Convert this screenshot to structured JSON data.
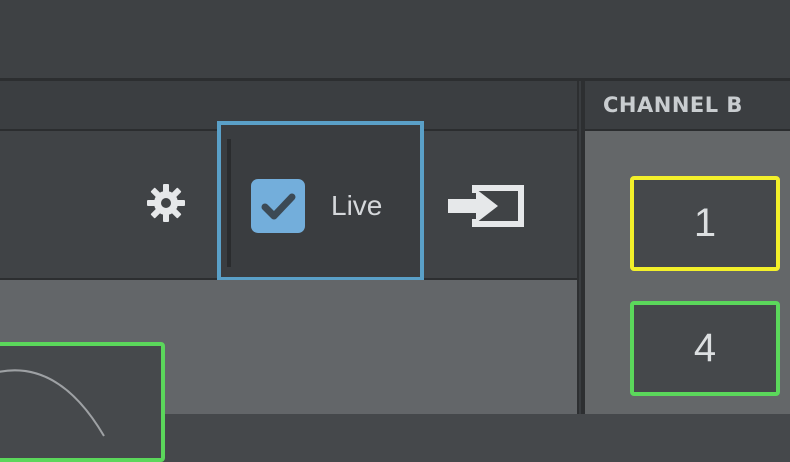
{
  "toolbar": {
    "settings_icon": "gear-icon",
    "live_toggle": {
      "label": "Live",
      "checked": true,
      "icon": "checkmark-icon",
      "accent": "#5aa0c8",
      "checkbox_color": "#73aedb"
    },
    "export_icon": "export-icon"
  },
  "channel_panel": {
    "title": "CHANNEL B",
    "channels": [
      {
        "label": "1",
        "border_color": "#f3f02a"
      },
      {
        "label": "4",
        "border_color": "#5bd75b"
      }
    ]
  },
  "colors": {
    "background": "#45484b",
    "green_accent": "#5bd75b",
    "yellow_accent": "#f3f02a"
  }
}
